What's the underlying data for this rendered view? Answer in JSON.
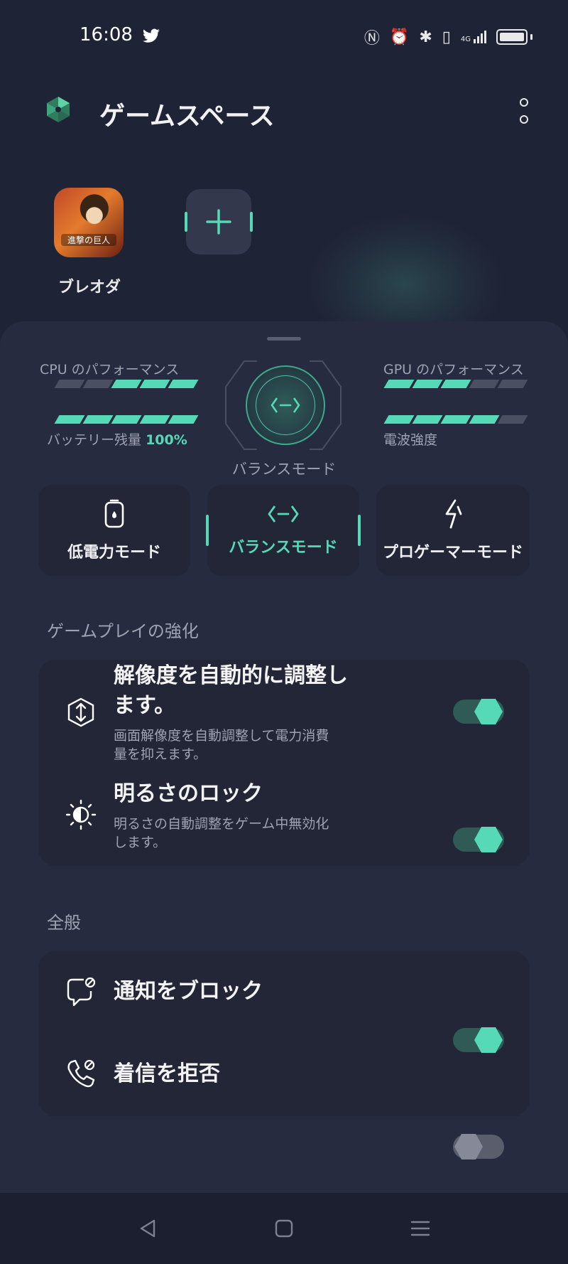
{
  "status_bar": {
    "time": "16:08",
    "icons": [
      "twitter-icon",
      "nfc-icon",
      "alarm-icon",
      "bluetooth-icon",
      "vibrate-icon",
      "signal-icon",
      "battery-icon"
    ],
    "network": "4G"
  },
  "header": {
    "title": "ゲームスペース"
  },
  "games": [
    {
      "label": "ブレオダ",
      "icon_text": "進撃の巨人"
    }
  ],
  "performance": {
    "cpu_label": "CPU のパフォーマンス",
    "gpu_label": "GPU のパフォーマンス",
    "battery_label": "バッテリー残量",
    "battery_value": "100%",
    "signal_label": "電波強度",
    "current_mode": "バランスモード",
    "cpu_level": 3,
    "gpu_level": 3,
    "battery_level": 5,
    "signal_level": 4
  },
  "modes": [
    {
      "label": "低電力モード",
      "active": false
    },
    {
      "label": "バランスモード",
      "active": true
    },
    {
      "label": "プロゲーマーモード",
      "active": false
    }
  ],
  "enhance_section": {
    "title": "ゲームプレイの強化",
    "items": [
      {
        "title": "解像度を自動的に調整し",
        "title_line2": "ます。",
        "desc": "画面解像度を自動調整して電力消費",
        "desc_line2": "量を抑えます。",
        "on": true
      },
      {
        "title": "明るさのロック",
        "desc": "明るさの自動調整をゲーム中無効化",
        "desc_line2": "します。",
        "on": true
      }
    ]
  },
  "general_section": {
    "title": "全般",
    "items": [
      {
        "title": "通知をブロック",
        "on": true
      },
      {
        "title": "着信を拒否",
        "on": false
      }
    ]
  },
  "colors": {
    "accent": "#56d9b7",
    "background": "#1f2336",
    "sheet": "#272b3f",
    "card": "#222637"
  }
}
